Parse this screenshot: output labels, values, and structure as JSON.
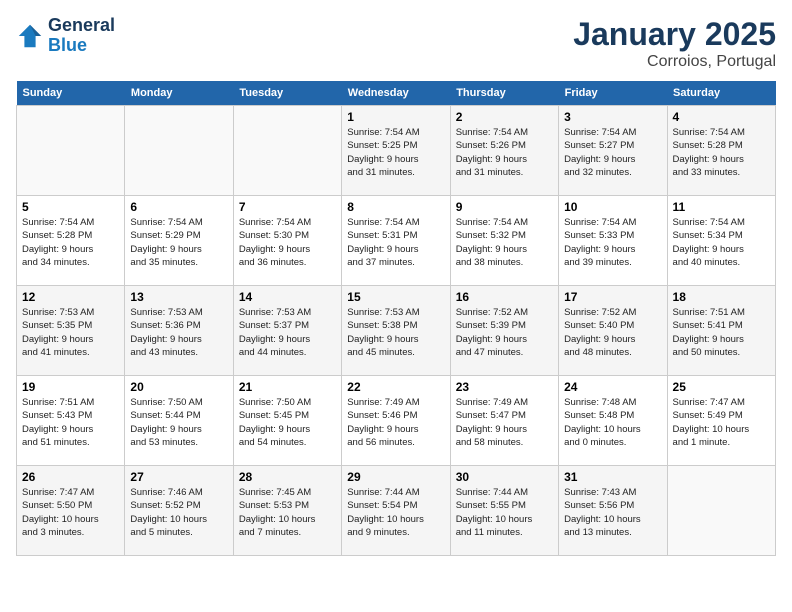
{
  "header": {
    "logo_line1": "General",
    "logo_line2": "Blue",
    "title": "January 2025",
    "subtitle": "Corroios, Portugal"
  },
  "weekdays": [
    "Sunday",
    "Monday",
    "Tuesday",
    "Wednesday",
    "Thursday",
    "Friday",
    "Saturday"
  ],
  "weeks": [
    [
      {
        "day": "",
        "info": ""
      },
      {
        "day": "",
        "info": ""
      },
      {
        "day": "",
        "info": ""
      },
      {
        "day": "1",
        "info": "Sunrise: 7:54 AM\nSunset: 5:25 PM\nDaylight: 9 hours\nand 31 minutes."
      },
      {
        "day": "2",
        "info": "Sunrise: 7:54 AM\nSunset: 5:26 PM\nDaylight: 9 hours\nand 31 minutes."
      },
      {
        "day": "3",
        "info": "Sunrise: 7:54 AM\nSunset: 5:27 PM\nDaylight: 9 hours\nand 32 minutes."
      },
      {
        "day": "4",
        "info": "Sunrise: 7:54 AM\nSunset: 5:28 PM\nDaylight: 9 hours\nand 33 minutes."
      }
    ],
    [
      {
        "day": "5",
        "info": "Sunrise: 7:54 AM\nSunset: 5:28 PM\nDaylight: 9 hours\nand 34 minutes."
      },
      {
        "day": "6",
        "info": "Sunrise: 7:54 AM\nSunset: 5:29 PM\nDaylight: 9 hours\nand 35 minutes."
      },
      {
        "day": "7",
        "info": "Sunrise: 7:54 AM\nSunset: 5:30 PM\nDaylight: 9 hours\nand 36 minutes."
      },
      {
        "day": "8",
        "info": "Sunrise: 7:54 AM\nSunset: 5:31 PM\nDaylight: 9 hours\nand 37 minutes."
      },
      {
        "day": "9",
        "info": "Sunrise: 7:54 AM\nSunset: 5:32 PM\nDaylight: 9 hours\nand 38 minutes."
      },
      {
        "day": "10",
        "info": "Sunrise: 7:54 AM\nSunset: 5:33 PM\nDaylight: 9 hours\nand 39 minutes."
      },
      {
        "day": "11",
        "info": "Sunrise: 7:54 AM\nSunset: 5:34 PM\nDaylight: 9 hours\nand 40 minutes."
      }
    ],
    [
      {
        "day": "12",
        "info": "Sunrise: 7:53 AM\nSunset: 5:35 PM\nDaylight: 9 hours\nand 41 minutes."
      },
      {
        "day": "13",
        "info": "Sunrise: 7:53 AM\nSunset: 5:36 PM\nDaylight: 9 hours\nand 43 minutes."
      },
      {
        "day": "14",
        "info": "Sunrise: 7:53 AM\nSunset: 5:37 PM\nDaylight: 9 hours\nand 44 minutes."
      },
      {
        "day": "15",
        "info": "Sunrise: 7:53 AM\nSunset: 5:38 PM\nDaylight: 9 hours\nand 45 minutes."
      },
      {
        "day": "16",
        "info": "Sunrise: 7:52 AM\nSunset: 5:39 PM\nDaylight: 9 hours\nand 47 minutes."
      },
      {
        "day": "17",
        "info": "Sunrise: 7:52 AM\nSunset: 5:40 PM\nDaylight: 9 hours\nand 48 minutes."
      },
      {
        "day": "18",
        "info": "Sunrise: 7:51 AM\nSunset: 5:41 PM\nDaylight: 9 hours\nand 50 minutes."
      }
    ],
    [
      {
        "day": "19",
        "info": "Sunrise: 7:51 AM\nSunset: 5:43 PM\nDaylight: 9 hours\nand 51 minutes."
      },
      {
        "day": "20",
        "info": "Sunrise: 7:50 AM\nSunset: 5:44 PM\nDaylight: 9 hours\nand 53 minutes."
      },
      {
        "day": "21",
        "info": "Sunrise: 7:50 AM\nSunset: 5:45 PM\nDaylight: 9 hours\nand 54 minutes."
      },
      {
        "day": "22",
        "info": "Sunrise: 7:49 AM\nSunset: 5:46 PM\nDaylight: 9 hours\nand 56 minutes."
      },
      {
        "day": "23",
        "info": "Sunrise: 7:49 AM\nSunset: 5:47 PM\nDaylight: 9 hours\nand 58 minutes."
      },
      {
        "day": "24",
        "info": "Sunrise: 7:48 AM\nSunset: 5:48 PM\nDaylight: 10 hours\nand 0 minutes."
      },
      {
        "day": "25",
        "info": "Sunrise: 7:47 AM\nSunset: 5:49 PM\nDaylight: 10 hours\nand 1 minute."
      }
    ],
    [
      {
        "day": "26",
        "info": "Sunrise: 7:47 AM\nSunset: 5:50 PM\nDaylight: 10 hours\nand 3 minutes."
      },
      {
        "day": "27",
        "info": "Sunrise: 7:46 AM\nSunset: 5:52 PM\nDaylight: 10 hours\nand 5 minutes."
      },
      {
        "day": "28",
        "info": "Sunrise: 7:45 AM\nSunset: 5:53 PM\nDaylight: 10 hours\nand 7 minutes."
      },
      {
        "day": "29",
        "info": "Sunrise: 7:44 AM\nSunset: 5:54 PM\nDaylight: 10 hours\nand 9 minutes."
      },
      {
        "day": "30",
        "info": "Sunrise: 7:44 AM\nSunset: 5:55 PM\nDaylight: 10 hours\nand 11 minutes."
      },
      {
        "day": "31",
        "info": "Sunrise: 7:43 AM\nSunset: 5:56 PM\nDaylight: 10 hours\nand 13 minutes."
      },
      {
        "day": "",
        "info": ""
      }
    ]
  ]
}
